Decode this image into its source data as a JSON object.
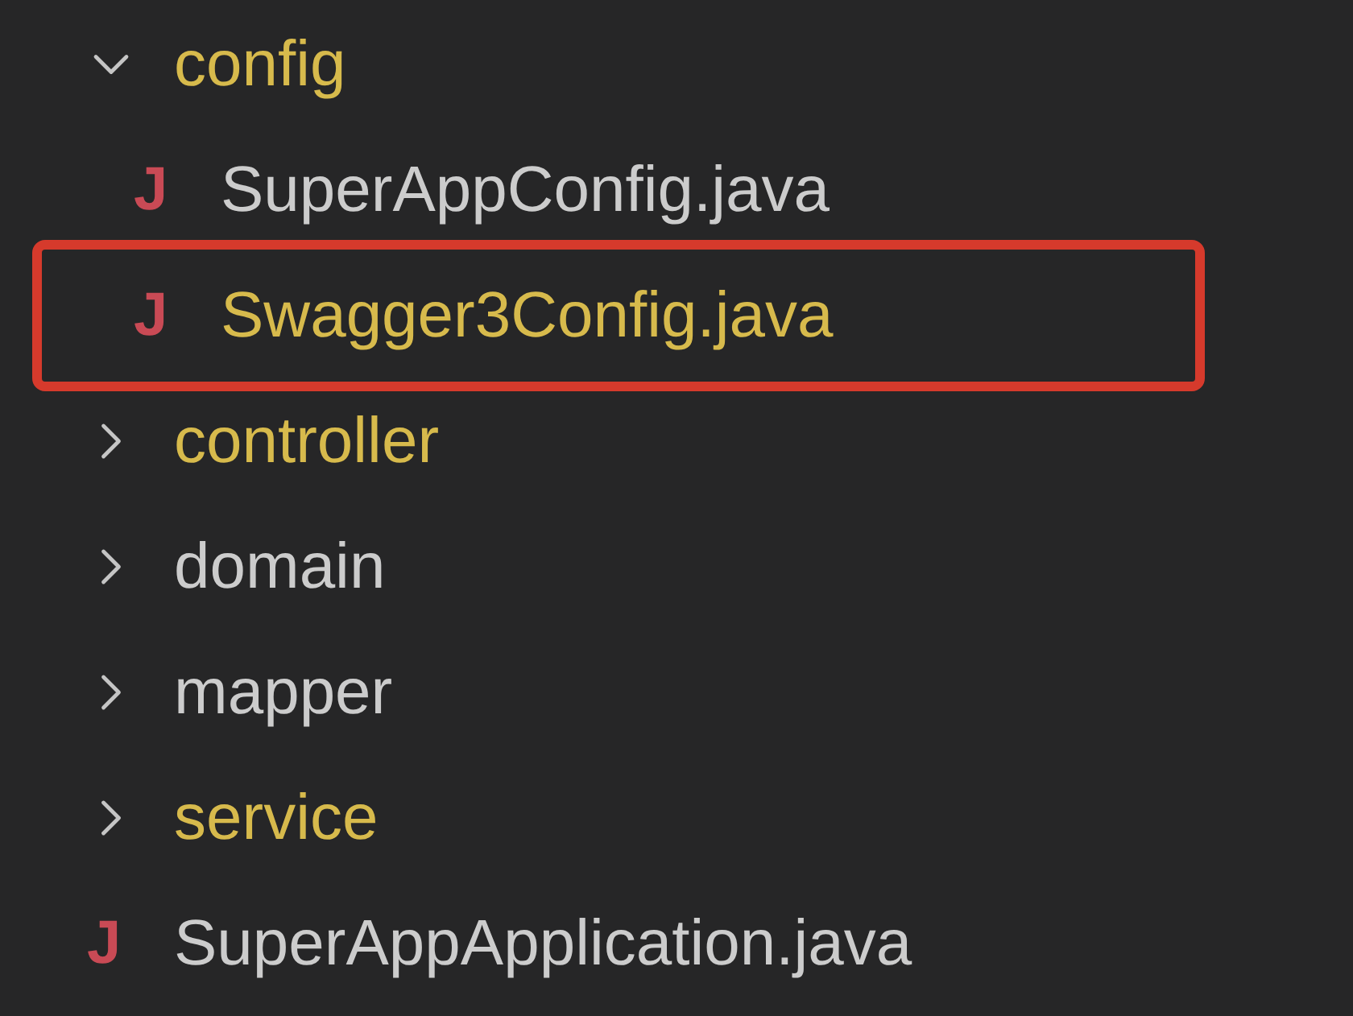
{
  "tree": [
    {
      "kind": "folder",
      "name": "config",
      "expanded": true,
      "modified": true,
      "highlighted": false,
      "children": [
        {
          "kind": "file",
          "icon": "J",
          "name": "SuperAppConfig.java",
          "modified": false,
          "highlighted": false
        },
        {
          "kind": "file",
          "icon": "J",
          "name": "Swagger3Config.java",
          "modified": true,
          "highlighted": true
        }
      ]
    },
    {
      "kind": "folder",
      "name": "controller",
      "expanded": false,
      "modified": true,
      "highlighted": false
    },
    {
      "kind": "folder",
      "name": "domain",
      "expanded": false,
      "modified": false,
      "highlighted": false
    },
    {
      "kind": "folder",
      "name": "mapper",
      "expanded": false,
      "modified": false,
      "highlighted": false
    },
    {
      "kind": "folder",
      "name": "service",
      "expanded": false,
      "modified": true,
      "highlighted": false
    },
    {
      "kind": "file",
      "icon": "J",
      "name": "SuperAppApplication.java",
      "modified": false,
      "highlighted": false
    }
  ]
}
